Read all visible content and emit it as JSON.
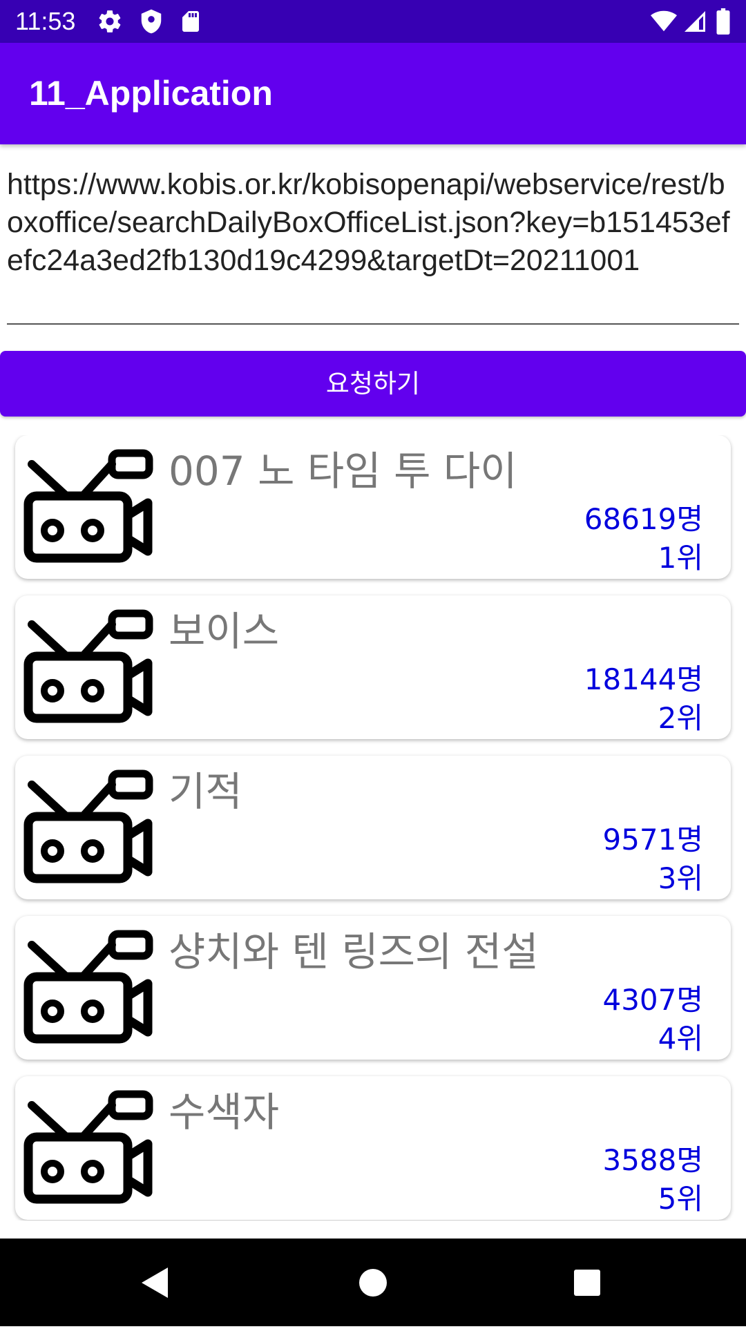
{
  "status_bar": {
    "time": "11:53",
    "icons_left": [
      "gear-icon",
      "shield-icon",
      "sd-card-icon"
    ],
    "icons_right": [
      "wifi-icon",
      "signal-icon",
      "battery-icon"
    ]
  },
  "app_bar": {
    "title": "11_Application",
    "color": "#6200ee"
  },
  "url_input": {
    "value": "https://www.kobis.or.kr/kobisopenapi/webservice/rest/boxoffice/searchDailyBoxOfficeList.json?key=b151453efefc24a3ed2fb130d19c4299&targetDt=20211001"
  },
  "request_button": {
    "label": "요청하기"
  },
  "movies": [
    {
      "title": "007 노 타임 투 다이",
      "audience": "68619명",
      "rank": "1위",
      "icon": "movie-camera-icon"
    },
    {
      "title": "보이스",
      "audience": "18144명",
      "rank": "2위",
      "icon": "movie-camera-icon"
    },
    {
      "title": "기적",
      "audience": "9571명",
      "rank": "3위",
      "icon": "movie-camera-icon"
    },
    {
      "title": "샹치와 텐 링즈의 전설",
      "audience": "4307명",
      "rank": "4위",
      "icon": "movie-camera-icon"
    },
    {
      "title": "수색자",
      "audience": "3588명",
      "rank": "5위",
      "icon": "movie-camera-icon"
    }
  ],
  "nav_bar": {
    "buttons": [
      "back-icon",
      "home-icon",
      "recents-icon"
    ]
  },
  "colors": {
    "status_bar": "#3700b3",
    "primary": "#6200ee",
    "audience_text": "#0000dd",
    "title_text": "#777777"
  }
}
